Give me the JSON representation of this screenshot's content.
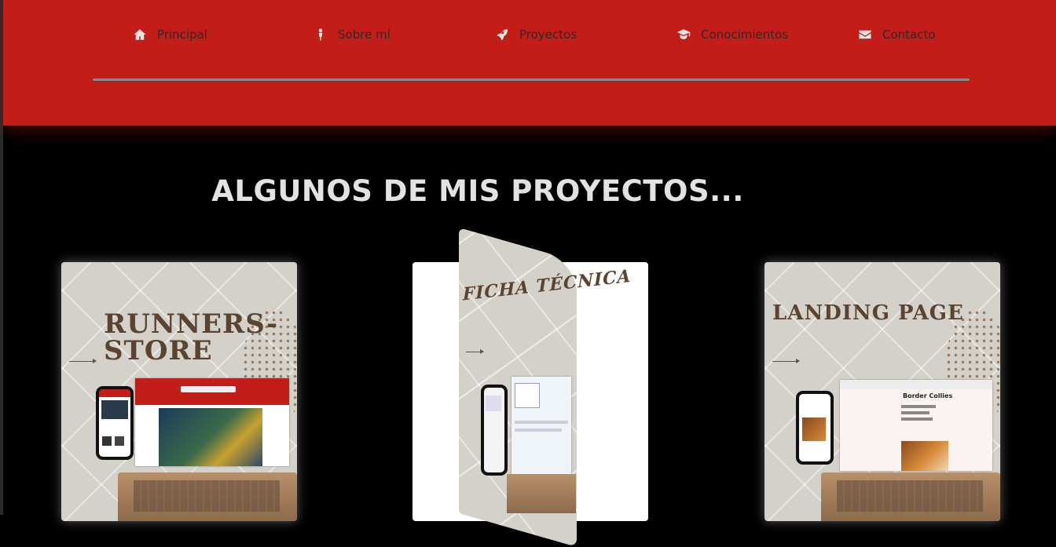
{
  "nav": {
    "items": [
      {
        "label": "Principal",
        "icon": "home-icon"
      },
      {
        "label": "Sobre mí",
        "icon": "person-icon"
      },
      {
        "label": "Proyectos",
        "icon": "rocket-icon"
      },
      {
        "label": "Conocimientos",
        "icon": "graduation-cap-icon"
      },
      {
        "label": "Contacto",
        "icon": "envelope-icon"
      }
    ]
  },
  "projects": {
    "title": "ALGUNOS DE MIS PROYECTOS...",
    "cards": [
      {
        "title_line1": "RUNNERS-",
        "title_line2": "STORE"
      },
      {
        "title": "FICHA TÉCNICA"
      },
      {
        "title": "LANDING PAGE",
        "screen_heading": "Border Collies"
      }
    ]
  },
  "colors": {
    "header": "#c21d18",
    "background": "#000000",
    "title_text": "#e2e2e2",
    "card_title": "#5b4331"
  }
}
